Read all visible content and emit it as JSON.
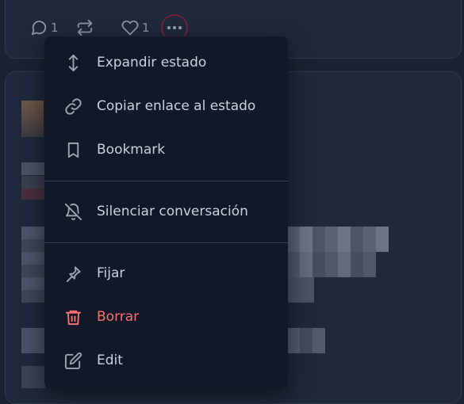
{
  "post_actions": {
    "reply_count": "1",
    "favourite_count": "1"
  },
  "menu": {
    "items": [
      {
        "label": "Expandir estado",
        "icon": "expand-vertical-icon"
      },
      {
        "label": "Copiar enlace al estado",
        "icon": "link-icon"
      },
      {
        "label": "Bookmark",
        "icon": "bookmark-icon"
      },
      {
        "label": "Silenciar conversación",
        "icon": "bell-off-icon"
      },
      {
        "label": "Fijar",
        "icon": "pin-icon"
      },
      {
        "label": "Borrar",
        "icon": "trash-icon",
        "danger": true
      },
      {
        "label": "Edit",
        "icon": "edit-icon"
      }
    ]
  },
  "colors": {
    "background": "#1b2333",
    "card": "#1f293b",
    "menu": "#111827",
    "danger": "#f87171",
    "highlight_ring": "#6b2439"
  }
}
